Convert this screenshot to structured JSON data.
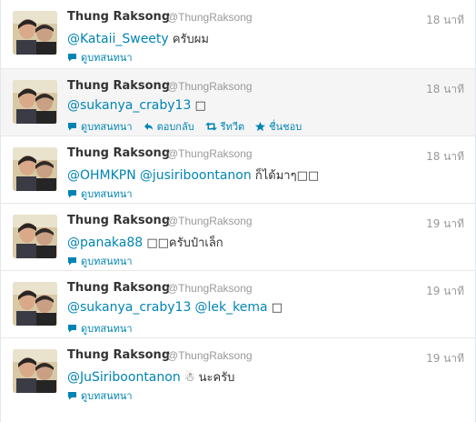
{
  "colors": {
    "link": "#0084b4",
    "name": "#333333",
    "meta": "#999999",
    "hover_background": "#f5f5f5"
  },
  "tweets": [
    {
      "fullname": "Thung Raksong",
      "username": "@ThungRaksong",
      "time": "18 นาที",
      "mentions": [
        "@Kataii_Sweety"
      ],
      "text": "ครับผม",
      "actions": [
        "ดูบทสนทนา"
      ]
    },
    {
      "fullname": "Thung Raksong",
      "username": "@ThungRaksong",
      "time": "18 นาที",
      "mentions": [
        "@sukanya_craby13"
      ],
      "text": "□",
      "actions": [
        "ดูบทสนทนา",
        "ตอบกลับ",
        "รีทวีต",
        "ชื่นชอบ"
      ]
    },
    {
      "fullname": "Thung Raksong",
      "username": "@ThungRaksong",
      "time": "18 นาที",
      "mentions": [
        "@OHMKPN",
        "@jusiriboontanon"
      ],
      "text": "ก็ได้มาๆ□□",
      "actions": [
        "ดูบทสนทนา"
      ]
    },
    {
      "fullname": "Thung Raksong",
      "username": "@ThungRaksong",
      "time": "19 นาที",
      "mentions": [
        "@panaka88"
      ],
      "text": "□□ครับป๋าเล็ก",
      "actions": [
        "ดูบทสนทนา"
      ]
    },
    {
      "fullname": "Thung Raksong",
      "username": "@ThungRaksong",
      "time": "19 นาที",
      "mentions": [
        "@sukanya_craby13",
        "@lek_kema"
      ],
      "text": "□",
      "actions": [
        "ดูบทสนทนา"
      ]
    },
    {
      "fullname": "Thung Raksong",
      "username": "@ThungRaksong",
      "time": "19 นาที",
      "mentions": [
        "@JuSiriboontanon"
      ],
      "text": "☃ นะครับ",
      "actions": [
        "ดูบทสนทนา"
      ]
    }
  ]
}
